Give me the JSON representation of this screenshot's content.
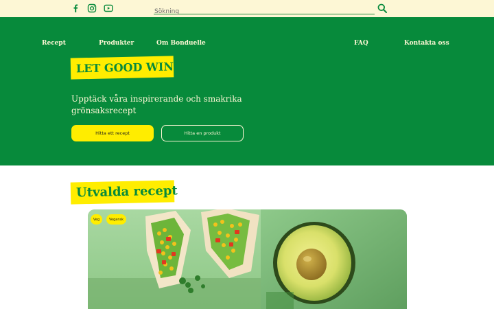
{
  "topbar": {
    "social_icons": [
      "facebook-icon",
      "instagram-icon",
      "youtube-icon"
    ],
    "search": {
      "placeholder": "Sökning",
      "value": ""
    },
    "search_icon": "search-icon"
  },
  "nav": {
    "left": [
      "Recept",
      "Produkter",
      "Om Bonduelle"
    ],
    "right": [
      "FAQ",
      "Kontakta oss"
    ]
  },
  "hero": {
    "tagline": "LET GOOD WIN",
    "subtitle_lines": [
      "Upptäck våra inspirerande och smakrika",
      "grönsaksrecept"
    ],
    "primary_button": "Hitta ett recept",
    "secondary_button": "Hitta en produkt"
  },
  "featured": {
    "heading": "Utvalda recept",
    "card": {
      "badges": [
        "Veg",
        "Vegansk"
      ]
    }
  },
  "colors": {
    "brand_green": "#078a3b",
    "brand_yellow": "#ffed00",
    "cream": "#fdf7d5"
  }
}
